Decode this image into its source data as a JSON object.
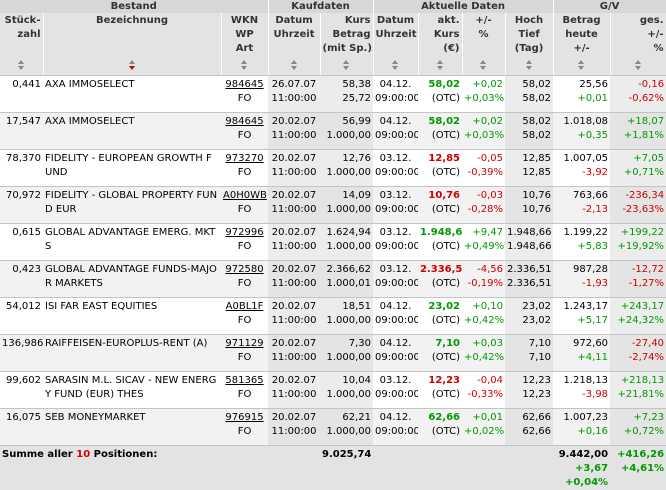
{
  "groups": {
    "bestand": "Bestand",
    "kaufdaten": "Kaufdaten",
    "aktuell": "Aktuelle Daten",
    "gv": "G/V"
  },
  "headers": {
    "stueckzahl": [
      "Stück-",
      "zahl"
    ],
    "bezeichnung": [
      "Bezeichnung"
    ],
    "wkn": [
      "WKN",
      "WP",
      "Art"
    ],
    "kauf_datum": [
      "Datum",
      "Uhrzeit"
    ],
    "kauf_kurs": [
      "Kurs",
      "Betrag",
      "(mit Sp.)"
    ],
    "akt_datum": [
      "Datum",
      "Uhrzeit"
    ],
    "akt_kurs": [
      "akt.",
      "Kurs",
      "(€)"
    ],
    "aend": [
      "+/-",
      "%"
    ],
    "hochtief": [
      "Hoch",
      "Tief",
      "(Tag)"
    ],
    "betrag": [
      "Betrag",
      "heute",
      "+/-"
    ],
    "ges": [
      "ges.",
      "+/-",
      "%"
    ]
  },
  "rows": [
    {
      "stk": "0,441",
      "name": "AXA IMMOSELECT",
      "wkn": "984645",
      "art": "FO",
      "kd": "26.07.07",
      "kt": "11:00:00",
      "kk": "58,38",
      "kb": "25,72",
      "ad": "04.12.",
      "at": "09:00:00",
      "ak": "58,02",
      "ak_color": "#009900",
      "ab": "(OTC)",
      "d1": "+0,02",
      "d1c": "pos",
      "d2": "+0,03%",
      "d2c": "pos",
      "hi": "58,02",
      "lo": "58,02",
      "bh": "25,56",
      "bd": "+0,01",
      "bdc": "pos",
      "g1": "-0,16",
      "g1c": "neg",
      "g2": "-0,62%",
      "g2c": "neg"
    },
    {
      "stk": "17,547",
      "name": "AXA IMMOSELECT",
      "wkn": "984645",
      "art": "FO",
      "kd": "20.02.07",
      "kt": "11:00:00",
      "kk": "56,99",
      "kb": "1.000,00",
      "ad": "04.12.",
      "at": "09:00:00",
      "ak": "58,02",
      "ak_color": "#009900",
      "ab": "(OTC)",
      "d1": "+0,02",
      "d1c": "pos",
      "d2": "+0,03%",
      "d2c": "pos",
      "hi": "58,02",
      "lo": "58,02",
      "bh": "1.018,08",
      "bd": "+0,35",
      "bdc": "pos",
      "g1": "+18,07",
      "g1c": "pos",
      "g2": "+1,81%",
      "g2c": "pos"
    },
    {
      "stk": "78,370",
      "name": "FIDELITY - EUROPEAN GROWTH FUND",
      "wkn": "973270",
      "art": "FO",
      "kd": "20.02.07",
      "kt": "11:00:00",
      "kk": "12,76",
      "kb": "1.000,00",
      "ad": "03.12.",
      "at": "09:00:00",
      "ak": "12,85",
      "ak_color": "#cc0000",
      "ab": "(OTC)",
      "d1": "-0,05",
      "d1c": "neg",
      "d2": "-0,39%",
      "d2c": "neg",
      "hi": "12,85",
      "lo": "12,85",
      "bh": "1.007,05",
      "bd": "-3,92",
      "bdc": "neg",
      "g1": "+7,05",
      "g1c": "pos",
      "g2": "+0,71%",
      "g2c": "pos"
    },
    {
      "stk": "70,972",
      "name": "FIDELITY - GLOBAL PROPERTY FUND EUR",
      "wkn": "A0H0WB",
      "art": "FO",
      "kd": "20.02.07",
      "kt": "11:00:00",
      "kk": "14,09",
      "kb": "1.000,00",
      "ad": "03.12.",
      "at": "09:00:00",
      "ak": "10,76",
      "ak_color": "#cc0000",
      "ab": "(OTC)",
      "d1": "-0,03",
      "d1c": "neg",
      "d2": "-0,28%",
      "d2c": "neg",
      "hi": "10,76",
      "lo": "10,76",
      "bh": "763,66",
      "bd": "-2,13",
      "bdc": "neg",
      "g1": "-236,34",
      "g1c": "neg",
      "g2": "-23,63%",
      "g2c": "neg"
    },
    {
      "stk": "0,615",
      "name": "GLOBAL ADVANTAGE EMERG. MKTS",
      "wkn": "972996",
      "art": "FO",
      "kd": "20.02.07",
      "kt": "11:00:00",
      "kk": "1.624,94",
      "kb": "1.000,00",
      "ad": "03.12.",
      "at": "09:00:00",
      "ak": "1.948,66",
      "ak_color": "#009900",
      "ab": "(OTC)",
      "d1": "+9,47",
      "d1c": "pos",
      "d2": "+0,49%",
      "d2c": "pos",
      "hi": "1.948,66",
      "lo": "1.948,66",
      "bh": "1.199,22",
      "bd": "+5,83",
      "bdc": "pos",
      "g1": "+199,22",
      "g1c": "pos",
      "g2": "+19,92%",
      "g2c": "pos"
    },
    {
      "stk": "0,423",
      "name": "GLOBAL ADVANTAGE FUNDS-MAJOR MARKETS",
      "wkn": "972580",
      "art": "FO",
      "kd": "20.02.07",
      "kt": "11:00:00",
      "kk": "2.366,62",
      "kb": "1.000,01",
      "ad": "03.12.",
      "at": "09:00:00",
      "ak": "2.336,51",
      "ak_color": "#cc0000",
      "ab": "(OTC)",
      "d1": "-4,56",
      "d1c": "neg",
      "d2": "-0,19%",
      "d2c": "neg",
      "hi": "2.336,51",
      "lo": "2.336,51",
      "bh": "987,28",
      "bd": "-1,93",
      "bdc": "neg",
      "g1": "-12,72",
      "g1c": "neg",
      "g2": "-1,27%",
      "g2c": "neg"
    },
    {
      "stk": "54,012",
      "name": "ISI FAR EAST EQUITIES",
      "wkn": "A0BL1F",
      "art": "FO",
      "kd": "20.02.07",
      "kt": "11:00:00",
      "kk": "18,51",
      "kb": "1.000,00",
      "ad": "04.12.",
      "at": "09:00:00",
      "ak": "23,02",
      "ak_color": "#009900",
      "ab": "(OTC)",
      "d1": "+0,10",
      "d1c": "pos",
      "d2": "+0,42%",
      "d2c": "pos",
      "hi": "23,02",
      "lo": "23,02",
      "bh": "1.243,17",
      "bd": "+5,17",
      "bdc": "pos",
      "g1": "+243,17",
      "g1c": "pos",
      "g2": "+24,32%",
      "g2c": "pos"
    },
    {
      "stk": "136,986",
      "name": "RAIFFEISEN-EUROPLUS-RENT (A)",
      "wkn": "971129",
      "art": "FO",
      "kd": "20.02.07",
      "kt": "11:00:00",
      "kk": "7,30",
      "kb": "1.000,00",
      "ad": "04.12.",
      "at": "09:00:00",
      "ak": "7,10",
      "ak_color": "#009900",
      "ab": "(OTC)",
      "d1": "+0,03",
      "d1c": "pos",
      "d2": "+0,42%",
      "d2c": "pos",
      "hi": "7,10",
      "lo": "7,10",
      "bh": "972,60",
      "bd": "+4,11",
      "bdc": "pos",
      "g1": "-27,40",
      "g1c": "neg",
      "g2": "-2,74%",
      "g2c": "neg"
    },
    {
      "stk": "99,602",
      "name": "SARASIN M.L. SICAV - NEW ENERGY FUND (EUR) THES",
      "wkn": "581365",
      "art": "FO",
      "kd": "20.02.07",
      "kt": "11:00:00",
      "kk": "10,04",
      "kb": "1.000,00",
      "ad": "03.12.",
      "at": "09:00:00",
      "ak": "12,23",
      "ak_color": "#cc0000",
      "ab": "(OTC)",
      "d1": "-0,04",
      "d1c": "neg",
      "d2": "-0,33%",
      "d2c": "neg",
      "hi": "12,23",
      "lo": "12,23",
      "bh": "1.218,13",
      "bd": "-3,98",
      "bdc": "neg",
      "g1": "+218,13",
      "g1c": "pos",
      "g2": "+21,81%",
      "g2c": "pos"
    },
    {
      "stk": "16,075",
      "name": "SEB MONEYMARKET",
      "wkn": "976915",
      "art": "FO",
      "kd": "20.02.07",
      "kt": "11:00:00",
      "kk": "62,21",
      "kb": "1.000,00",
      "ad": "04.12.",
      "at": "09:00:00",
      "ak": "62,66",
      "ak_color": "#009900",
      "ab": "(OTC)",
      "d1": "+0,01",
      "d1c": "pos",
      "d2": "+0,02%",
      "d2c": "pos",
      "hi": "62,66",
      "lo": "62,66",
      "bh": "1.007,23",
      "bd": "+0,16",
      "bdc": "pos",
      "g1": "+7,23",
      "g1c": "pos",
      "g2": "+0,72%",
      "g2c": "pos"
    }
  ],
  "summary": {
    "label_prefix": "Summe aller",
    "count": "10",
    "label_suffix": "Positionen:",
    "kauf_total": "9.025,74",
    "betrag_total": "9.442,00",
    "betrag_delta": "+3,67",
    "betrag_delta_pct": "+0,04%",
    "ges_total": "+416,26",
    "ges_pct": "+4,61%"
  },
  "colors": {
    "positive": "#009900",
    "negative": "#cc0000",
    "sort_active": "#cc0000"
  }
}
